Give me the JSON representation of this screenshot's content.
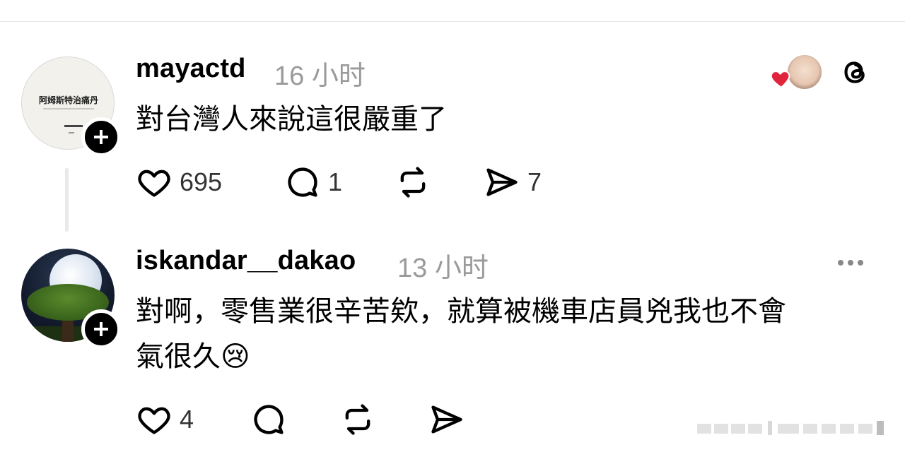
{
  "posts": [
    {
      "username": "mayactd",
      "timestamp": "16 小时",
      "avatar_text": "阿姆斯特治痛丹",
      "text_lines": [
        "對台灣人來說這很嚴重了"
      ],
      "actions": {
        "likes": "695",
        "comments": "1",
        "reposts": "",
        "shares": "7"
      }
    },
    {
      "username": "iskandar__dakao",
      "timestamp": "13 小时",
      "text_lines": [
        "對啊，零售業很辛苦欸，就算被機車店員兇我也不會",
        "氣很久😢"
      ],
      "actions": {
        "likes": "4",
        "comments": "",
        "reposts": "",
        "shares": ""
      }
    }
  ],
  "icons": {
    "like": "heart-outline-icon",
    "comment": "speech-bubble-icon",
    "repost": "repost-arrows-icon",
    "share": "paper-plane-icon",
    "follow": "plus-icon",
    "more": "ellipsis-icon",
    "threads": "threads-logo-icon",
    "liked_badge": "red-heart-icon"
  },
  "colors": {
    "text": "#000000",
    "muted": "#9a9a9a",
    "heart": "#e0243c",
    "background": "#ffffff"
  }
}
